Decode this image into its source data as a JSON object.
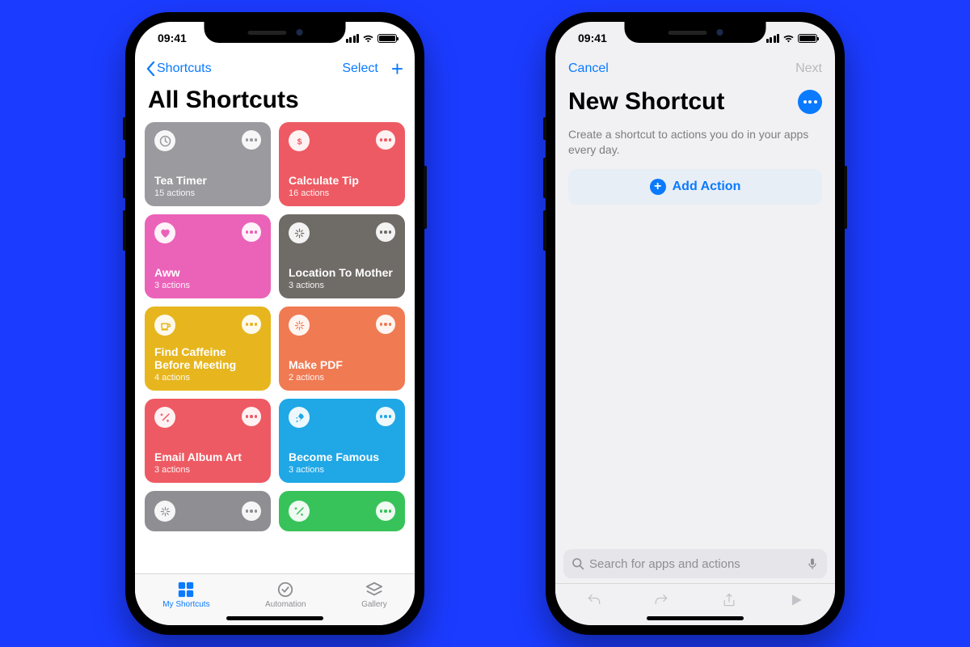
{
  "status": {
    "time": "09:41"
  },
  "left": {
    "back_label": "Shortcuts",
    "select_label": "Select",
    "title": "All Shortcuts",
    "cards": [
      {
        "name": "Tea Timer",
        "sub": "15 actions",
        "color": "#9a9a9f",
        "icon": "clock",
        "dot": "#9a9a9f"
      },
      {
        "name": "Calculate Tip",
        "sub": "16 actions",
        "color": "#ee5a63",
        "icon": "dollar",
        "dot": "#ee5a63"
      },
      {
        "name": "Aww",
        "sub": "3 actions",
        "color": "#eb62b9",
        "icon": "heart",
        "dot": "#eb62b9"
      },
      {
        "name": "Location To Mother",
        "sub": "3 actions",
        "color": "#6f6b67",
        "icon": "sparkle",
        "dot": "#6f6b67"
      },
      {
        "name": "Find Caffeine Before Meeting",
        "sub": "4 actions",
        "color": "#e7b61e",
        "icon": "cup",
        "dot": "#e7b61e"
      },
      {
        "name": "Make PDF",
        "sub": "2 actions",
        "color": "#f07a52",
        "icon": "sparkle",
        "dot": "#f07a52"
      },
      {
        "name": "Email Album Art",
        "sub": "3 actions",
        "color": "#ee5a63",
        "icon": "wand",
        "dot": "#ee5a63"
      },
      {
        "name": "Become Famous",
        "sub": "3 actions",
        "color": "#1fa7e6",
        "icon": "rocket",
        "dot": "#1fa7e6"
      },
      {
        "name": "",
        "sub": "",
        "color": "#8e8e93",
        "icon": "sparkle",
        "dot": "#8e8e93",
        "half": true
      },
      {
        "name": "",
        "sub": "",
        "color": "#38c35a",
        "icon": "wand",
        "dot": "#38c35a",
        "half": true
      }
    ],
    "tabs": [
      {
        "label": "My Shortcuts",
        "active": true
      },
      {
        "label": "Automation",
        "active": false
      },
      {
        "label": "Gallery",
        "active": false
      }
    ]
  },
  "right": {
    "cancel": "Cancel",
    "next": "Next",
    "title": "New Shortcut",
    "desc": "Create a shortcut to actions you do in your apps every day.",
    "add_action": "Add Action",
    "search_placeholder": "Search for apps and actions"
  }
}
